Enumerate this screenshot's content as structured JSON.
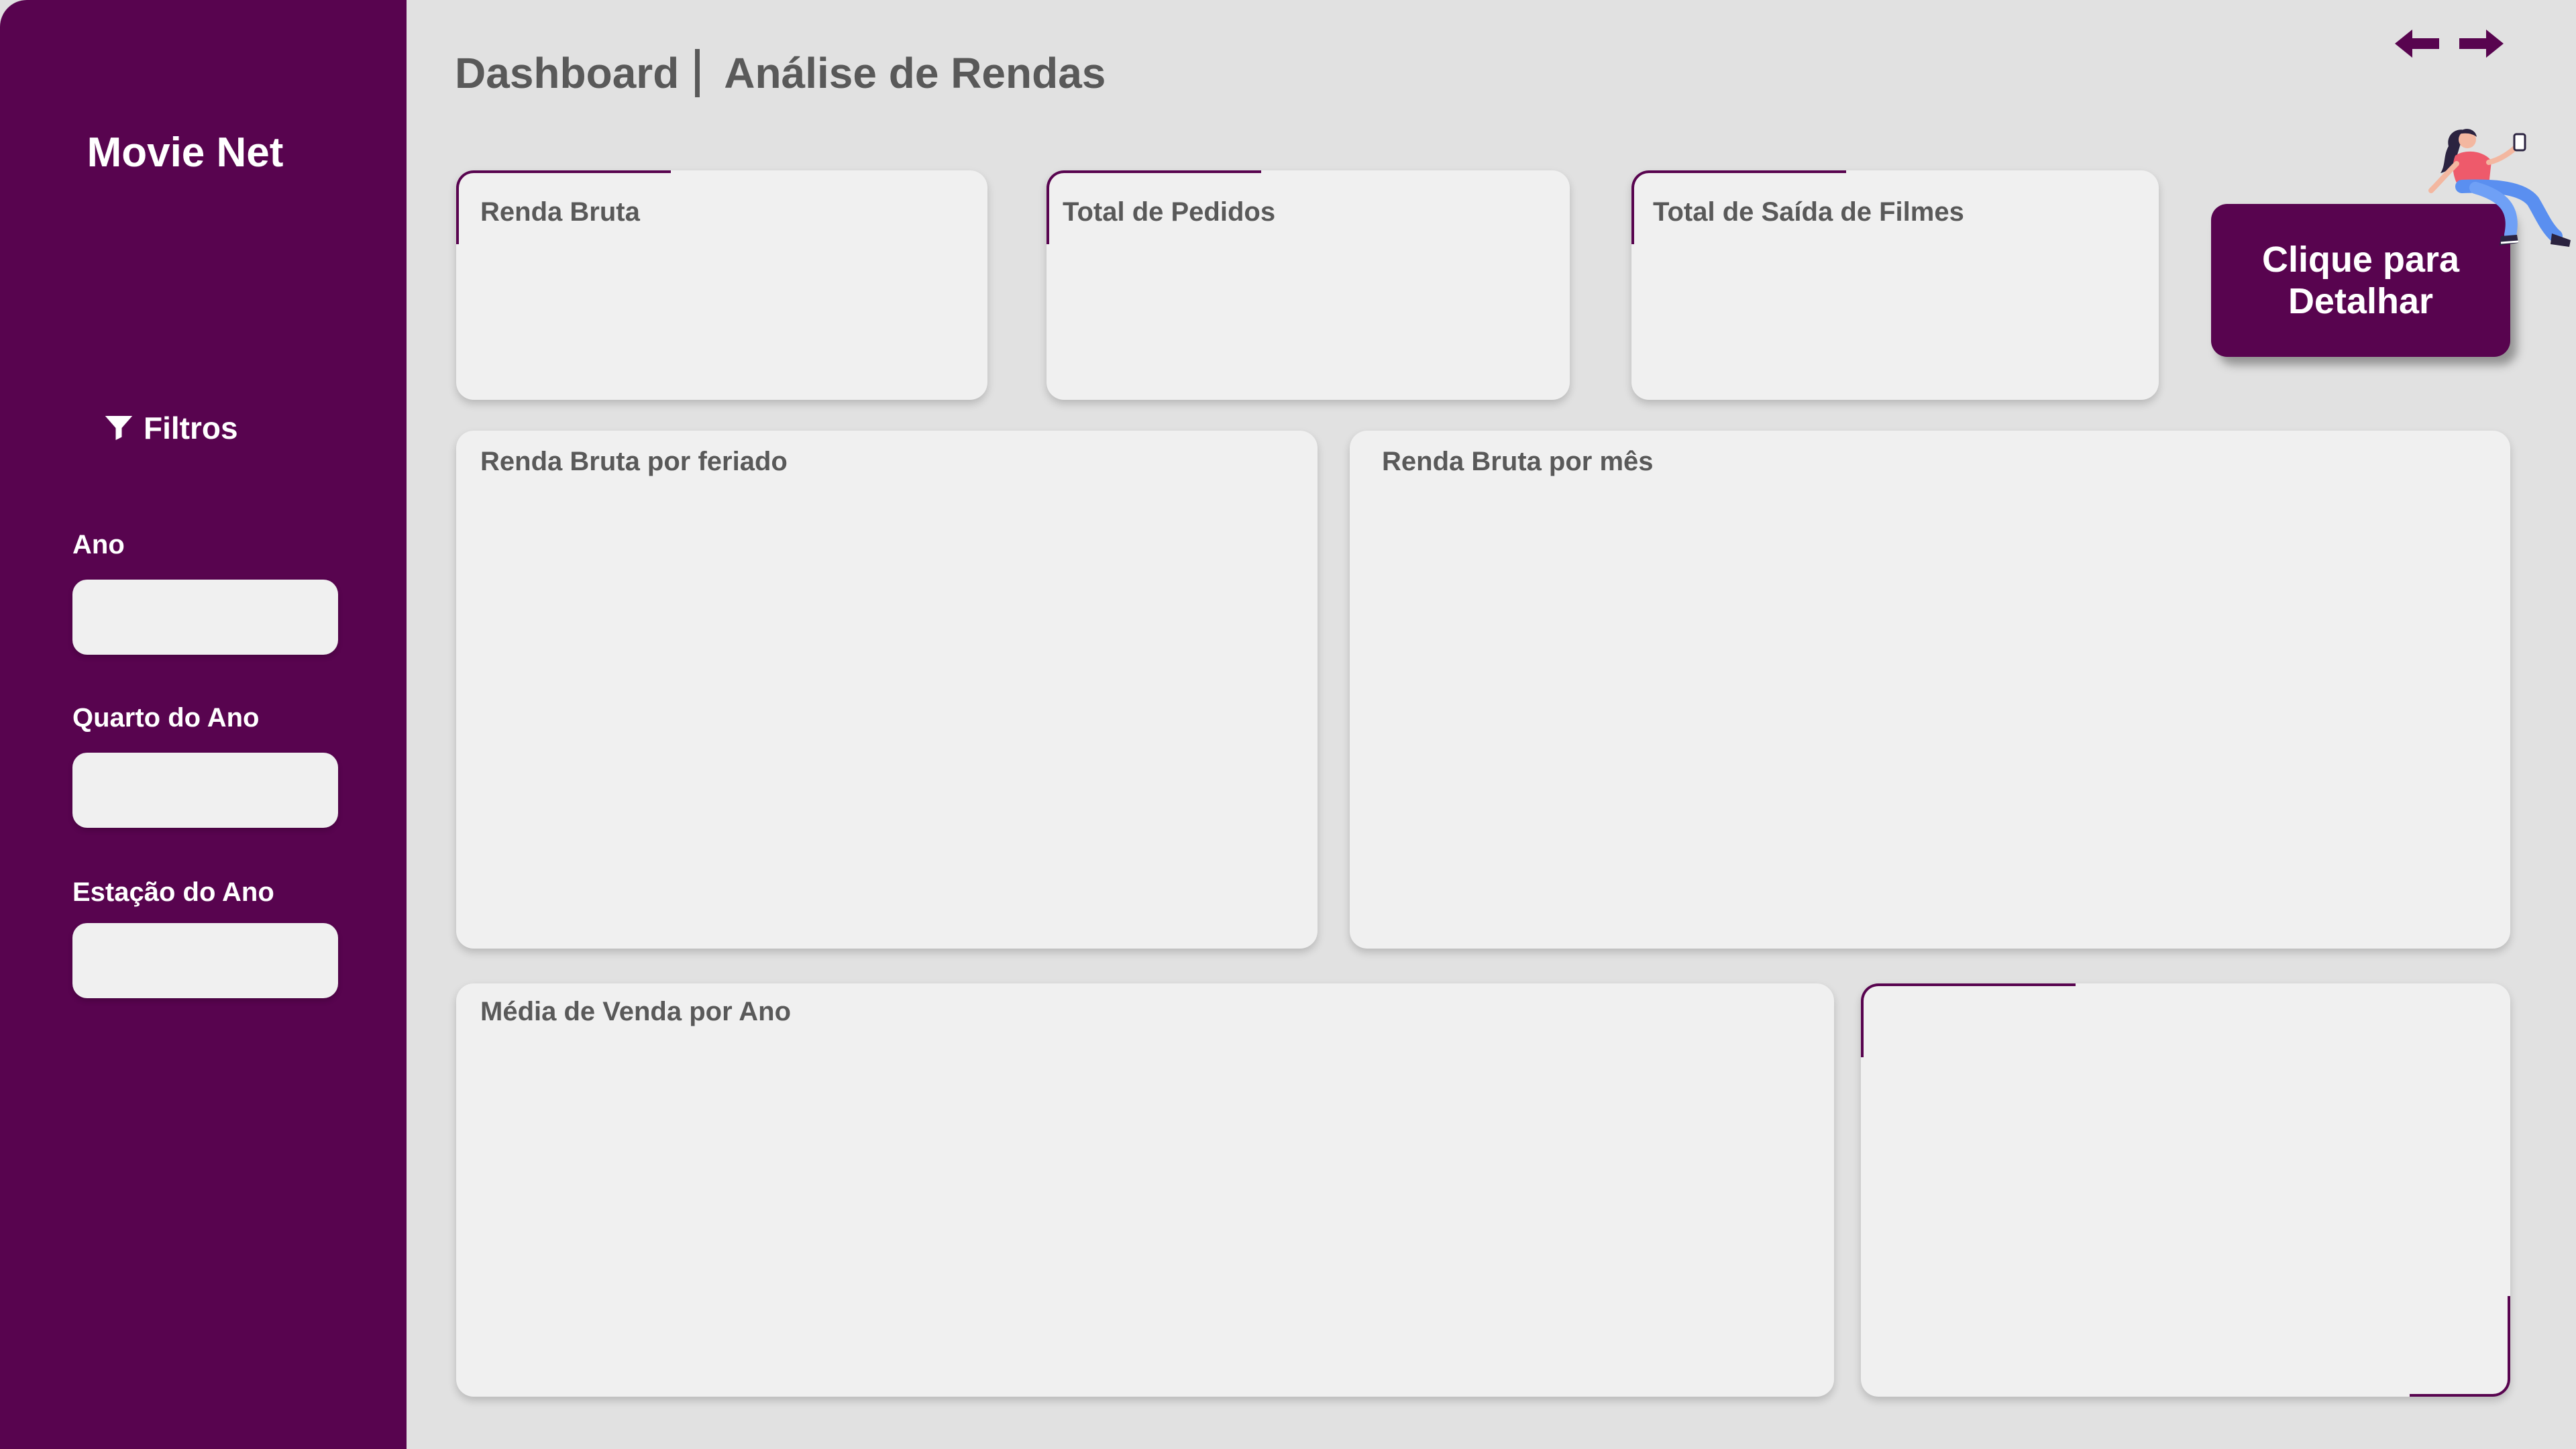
{
  "sidebar": {
    "brand": "Movie Net",
    "filters_title": "Filtros",
    "filters": [
      {
        "label": "Ano",
        "value": ""
      },
      {
        "label": "Quarto do Ano",
        "value": ""
      },
      {
        "label": "Estação do Ano",
        "value": ""
      }
    ]
  },
  "header": {
    "title": "Dashboard",
    "subtitle": "Análise de Rendas"
  },
  "nav": {
    "back_icon": "arrow-left-icon",
    "forward_icon": "arrow-right-icon"
  },
  "kpis": [
    {
      "title": "Renda Bruta"
    },
    {
      "title": "Total de Pedidos"
    },
    {
      "title": "Total de Saída de Filmes"
    }
  ],
  "detail_button": {
    "label_line1": "Clique para",
    "label_line2": "Detalhar"
  },
  "charts": {
    "holiday": {
      "title": "Renda Bruta por feriado"
    },
    "month": {
      "title": "Renda Bruta por mês"
    },
    "year_avg": {
      "title": "Média de Venda por Ano"
    }
  },
  "colors": {
    "accent": "#58044f",
    "background": "#e1e1e1",
    "card": "#f0f0f0",
    "text": "#595959"
  }
}
